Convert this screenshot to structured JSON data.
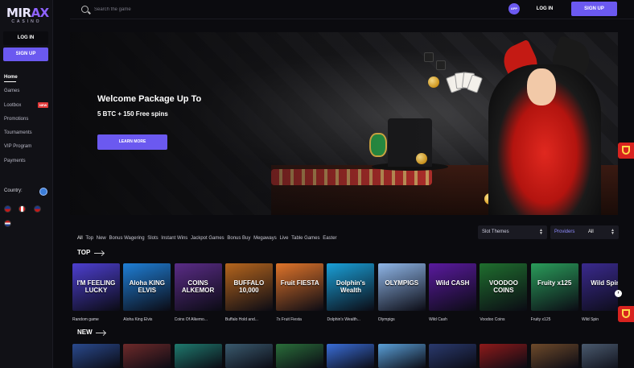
{
  "brand": {
    "logo_main": "MIRAX",
    "logo_sub": "CASINO"
  },
  "sidebar": {
    "login_label": "LOG IN",
    "signup_label": "SIGN UP",
    "items": [
      {
        "label": "Home",
        "active": true
      },
      {
        "label": "Games"
      },
      {
        "label": "Lootbox",
        "badge": "NEW"
      },
      {
        "label": "Promotions"
      },
      {
        "label": "Tournaments"
      },
      {
        "label": "VIP Program"
      },
      {
        "label": "Payments"
      }
    ],
    "country_label": "Country:"
  },
  "topbar": {
    "search_placeholder": "Search the game",
    "app_label": "APP",
    "login_label": "LOG IN",
    "signup_label": "SIGN UP"
  },
  "hero": {
    "title": "Welcome Package Up To",
    "subtitle": "5 BTC + 150 Free spins",
    "cta_label": "LEARN MORE",
    "slide_count": 7,
    "active_slide": 1
  },
  "filters": {
    "tabs": [
      "All",
      "Top",
      "New",
      "Bonus Wagering",
      "Slots",
      "Instant Wins",
      "Jackpot Games",
      "Bonus Buy",
      "Megaways",
      "Live",
      "Table Games",
      "Easter"
    ],
    "themes_label": "Slot Themes",
    "providers_label": "Providers",
    "providers_value": "All"
  },
  "sections": {
    "top_title": "TOP",
    "new_title": "NEW",
    "top_games": [
      {
        "name": "Random game",
        "art": "I'M FEELING LUCKY",
        "color": "#4d3fd0"
      },
      {
        "name": "Aloha King Elvis",
        "art": "Aloha KING ELVIS",
        "color": "#1f7fd6"
      },
      {
        "name": "Coins Of Alkemo...",
        "art": "COINS ALKEMOR",
        "color": "#5a2c86"
      },
      {
        "name": "Buffalo Hold and...",
        "art": "BUFFALO 10,000",
        "color": "#b5651d"
      },
      {
        "name": "7s Fruit Fiesta",
        "art": "Fruit FIESTA",
        "color": "#e0742a"
      },
      {
        "name": "Dolphin's Wealth...",
        "art": "Dolphin's Wealth",
        "color": "#1aa0d8"
      },
      {
        "name": "Olympigs",
        "art": "OLYMPIGS",
        "color": "#8fb6e8"
      },
      {
        "name": "Wild Cash",
        "art": "Wild CASH",
        "color": "#5a1a9e"
      },
      {
        "name": "Voodoo Coins",
        "art": "VOODOO COINS",
        "color": "#1f6e2e"
      },
      {
        "name": "Fruity x125",
        "art": "Fruity x125",
        "color": "#2a9c5a"
      },
      {
        "name": "Wild Spin",
        "art": "Wild Spin",
        "color": "#3a2a8e"
      }
    ],
    "new_colors": [
      "#2a4a8e",
      "#6e2a2a",
      "#1f7a6e",
      "#3a5a6e",
      "#2a6e3a",
      "#3a6ed8",
      "#5aa0d8",
      "#2a3a6e",
      "#8e1a1a",
      "#6e4a2a",
      "#4a5a6e"
    ]
  },
  "colors": {
    "accent": "#6b59f0",
    "background": "#0b0b0f",
    "badge": "#e23a3a",
    "widget": "#d8231f"
  }
}
